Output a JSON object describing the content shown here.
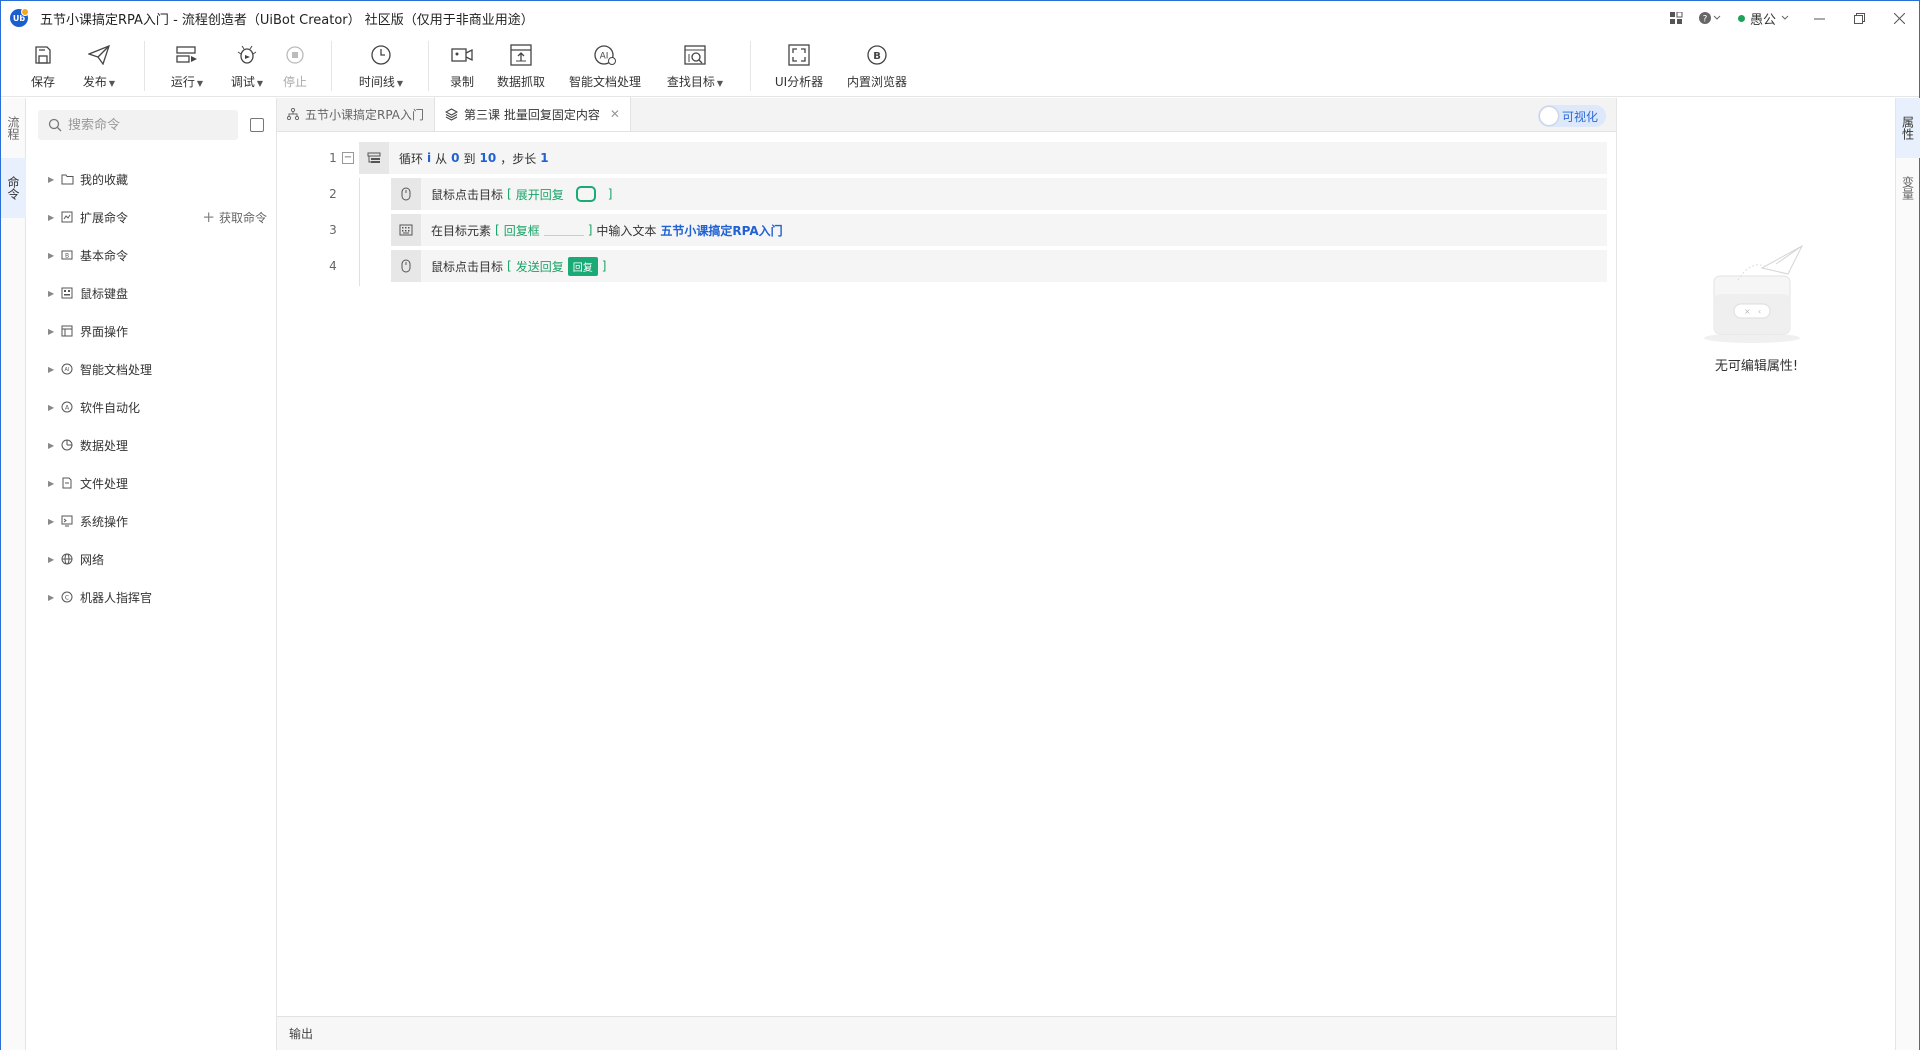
{
  "window": {
    "title": "五节小课搞定RPA入门 - 流程创造者（UiBot Creator） 社区版（仅用于非商业用途）",
    "logo_text": "Ub",
    "user": "愚公",
    "accent": "#2c6ad8"
  },
  "toolbar": {
    "save": "保存",
    "publish": "发布",
    "run": "运行",
    "debug": "调试",
    "stop": "停止",
    "timeline": "时间线",
    "record": "录制",
    "data_scrape": "数据抓取",
    "smart_doc": "智能文档处理",
    "find_target": "查找目标",
    "ui_analyzer": "UI分析器",
    "browser": "内置浏览器"
  },
  "left_rail": {
    "flow": "流程",
    "command": "命令"
  },
  "commands": {
    "search_placeholder": "搜索命令",
    "get_commands": "获取命令",
    "items": [
      {
        "label": "我的收藏",
        "icon": "folder-icon"
      },
      {
        "label": "扩展命令",
        "icon": "extension-icon"
      },
      {
        "label": "基本命令",
        "icon": "basic-icon"
      },
      {
        "label": "鼠标键盘",
        "icon": "keyboard-icon"
      },
      {
        "label": "界面操作",
        "icon": "window-icon"
      },
      {
        "label": "智能文档处理",
        "icon": "ai-doc-icon"
      },
      {
        "label": "软件自动化",
        "icon": "automation-icon"
      },
      {
        "label": "数据处理",
        "icon": "pie-icon"
      },
      {
        "label": "文件处理",
        "icon": "file-icon"
      },
      {
        "label": "系统操作",
        "icon": "system-icon"
      },
      {
        "label": "网络",
        "icon": "globe-icon"
      },
      {
        "label": "机器人指挥官",
        "icon": "commander-icon"
      }
    ]
  },
  "tabs": [
    {
      "label": "五节小课搞定RPA入门",
      "icon": "flow-icon"
    },
    {
      "label": "第三课 批量回复固定内容",
      "icon": "layers-icon"
    }
  ],
  "visualize_toggle": "可视化",
  "code_lines": [
    {
      "num": "1",
      "text_a": "循环",
      "var": "i",
      "text_b": "从",
      "from": "0",
      "text_c": "到",
      "to": "10",
      "text_d": "，步长",
      "step": "1"
    },
    {
      "num": "2",
      "text_a": "鼠标点击目标",
      "bracket_open": "[",
      "target": "展开回复",
      "bracket_close": "]"
    },
    {
      "num": "3",
      "text_a": "在目标元素",
      "bracket_open": "[",
      "target": "回复框",
      "bracket_close": "]",
      "text_b": "中输入文本",
      "value": "五节小课搞定RPA入门"
    },
    {
      "num": "4",
      "text_a": "鼠标点击目标",
      "bracket_open": "[",
      "target": "发送回复",
      "thumb": "回复",
      "bracket_close": "]"
    }
  ],
  "output_label": "输出",
  "properties": {
    "empty_text": "无可编辑属性!",
    "rail_props": "属性",
    "rail_vars": "变量"
  }
}
